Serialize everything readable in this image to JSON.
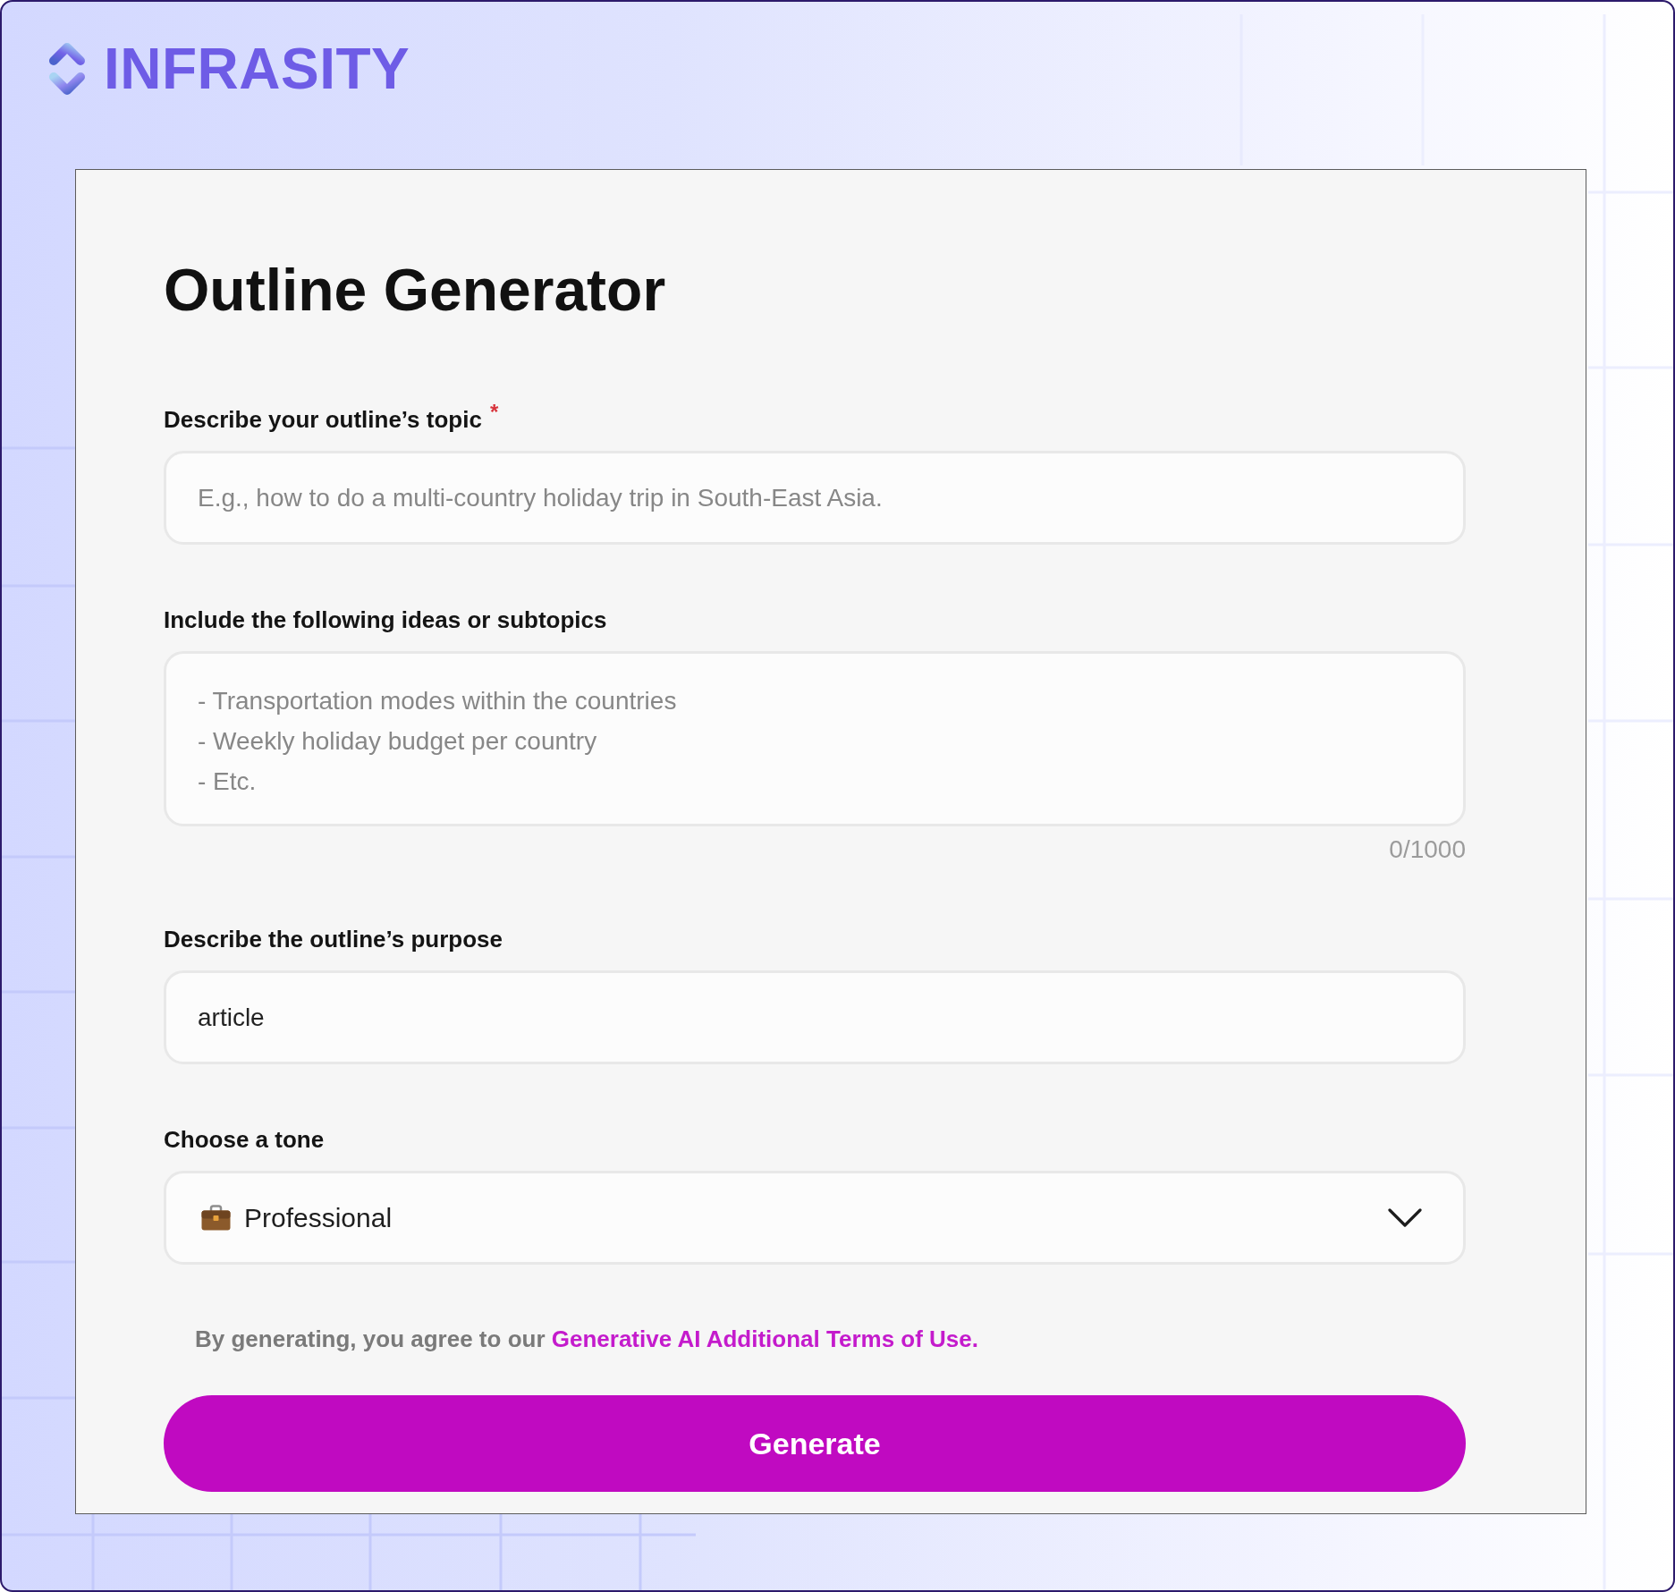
{
  "logo": {
    "text": "INFRASITY"
  },
  "form": {
    "title": "Outline Generator",
    "fields": [
      {
        "kind": "input",
        "label": "Describe your outline’s topic",
        "required_mark": "*",
        "placeholder": "E.g., how to do a multi-country holiday trip in South-East Asia."
      },
      {
        "kind": "textarea",
        "label": "Include the following ideas or subtopics",
        "placeholder": "- Transportation modes within the countries\n- Weekly holiday budget per country\n- Etc.",
        "counter": "0/1000"
      },
      {
        "kind": "input",
        "label": "Describe the outline’s purpose",
        "value": "article"
      },
      {
        "kind": "select",
        "label": "Choose a tone",
        "value": "Professional"
      }
    ],
    "terms": {
      "text": "By generating, you agree to our",
      "link": "Generative AI Additional Terms of Use."
    },
    "button": "Generate"
  }
}
